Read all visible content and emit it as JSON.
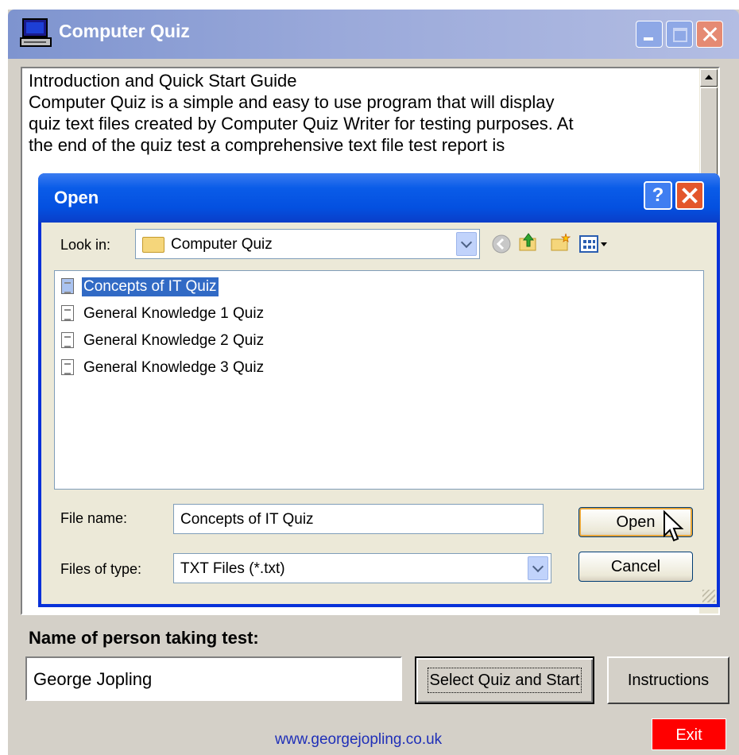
{
  "window": {
    "title": "Computer Quiz",
    "icon": "computer-icon"
  },
  "intro": {
    "lines": [
      "Introduction and Quick Start Guide",
      "Computer Quiz is a simple and easy to use program that will display",
      "quiz text files created by Computer Quiz Writer for testing purposes. At",
      "the end of the quiz test a comprehensive text file test report is"
    ]
  },
  "dialog": {
    "title": "Open",
    "help_label": "?",
    "look_in_label": "Look in:",
    "look_in_value": "Computer Quiz",
    "files": [
      {
        "name": "Concepts of IT Quiz",
        "selected": true
      },
      {
        "name": "General Knowledge 1 Quiz",
        "selected": false
      },
      {
        "name": "General Knowledge 2 Quiz",
        "selected": false
      },
      {
        "name": "General Knowledge 3 Quiz",
        "selected": false
      }
    ],
    "file_name_label": "File name:",
    "file_name_value": "Concepts of IT Quiz",
    "file_type_label": "Files of type:",
    "file_type_value": "TXT Files (*.txt)",
    "open_label": "Open",
    "cancel_label": "Cancel"
  },
  "form": {
    "name_label": "Name of person taking test:",
    "name_value": "George Jopling",
    "select_label": "Select Quiz and Start",
    "instructions_label": "Instructions",
    "exit_label": "Exit",
    "website": "www.georgejopling.co.uk"
  },
  "colors": {
    "title_active": "#0a5ce8",
    "exit": "#ff0000",
    "link": "#1f2fb8",
    "selection": "#316ac5"
  }
}
